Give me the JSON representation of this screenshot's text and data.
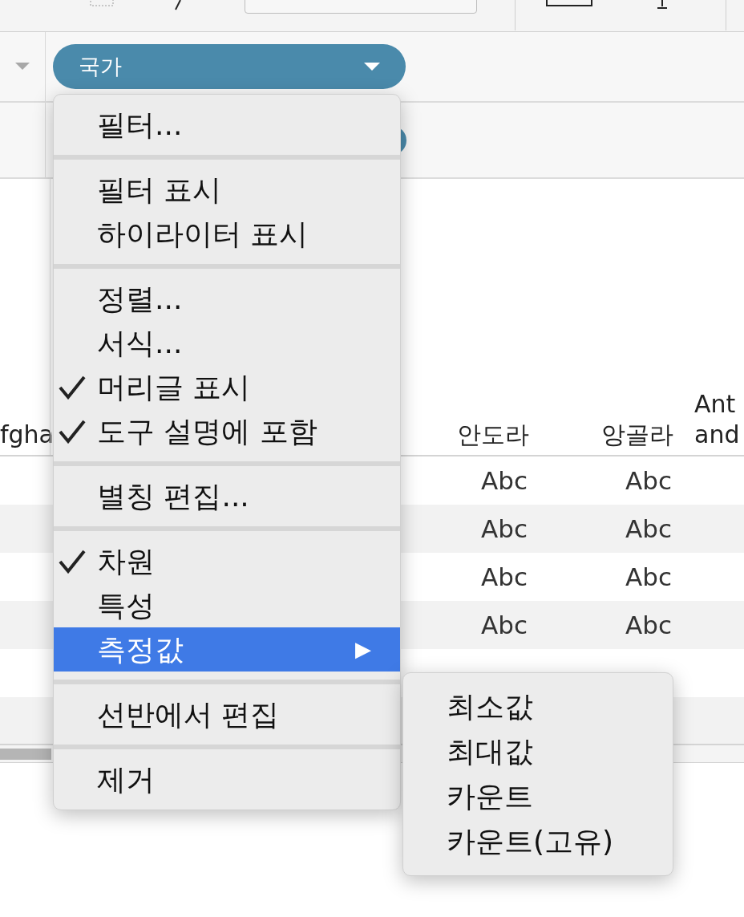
{
  "shelf": {
    "pill": {
      "label": "국가"
    }
  },
  "row_header": {
    "label": "fgha"
  },
  "table": {
    "columns": [
      {
        "lines": [
          "안도라"
        ]
      },
      {
        "lines": [
          "앙골라"
        ]
      },
      {
        "lines": [
          "Ant",
          "and"
        ]
      }
    ],
    "rows": [
      [
        "Abc",
        "Abc"
      ],
      [
        "Abc",
        "Abc"
      ],
      [
        "Abc",
        "Abc"
      ],
      [
        "Abc",
        "Abc"
      ]
    ]
  },
  "menu": {
    "groups": [
      [
        {
          "label": "필터...",
          "checked": false,
          "selected": false
        }
      ],
      [
        {
          "label": "필터 표시",
          "checked": false,
          "selected": false
        },
        {
          "label": "하이라이터 표시",
          "checked": false,
          "selected": false
        }
      ],
      [
        {
          "label": "정렬...",
          "checked": false,
          "selected": false
        },
        {
          "label": "서식...",
          "checked": false,
          "selected": false
        },
        {
          "label": "머리글 표시",
          "checked": true,
          "selected": false
        },
        {
          "label": "도구 설명에 포함",
          "checked": true,
          "selected": false
        }
      ],
      [
        {
          "label": "별칭 편집...",
          "checked": false,
          "selected": false
        }
      ],
      [
        {
          "label": "차원",
          "checked": true,
          "selected": false
        },
        {
          "label": "특성",
          "checked": false,
          "selected": false
        },
        {
          "label": "측정값",
          "checked": false,
          "selected": true,
          "submenu": "▶"
        }
      ],
      [
        {
          "label": "선반에서 편집",
          "checked": false,
          "selected": false
        }
      ],
      [
        {
          "label": "제거",
          "checked": false,
          "selected": false
        }
      ]
    ]
  },
  "submenu": {
    "items": [
      "최소값",
      "최대값",
      "카운트",
      "카운트(고유)"
    ]
  }
}
